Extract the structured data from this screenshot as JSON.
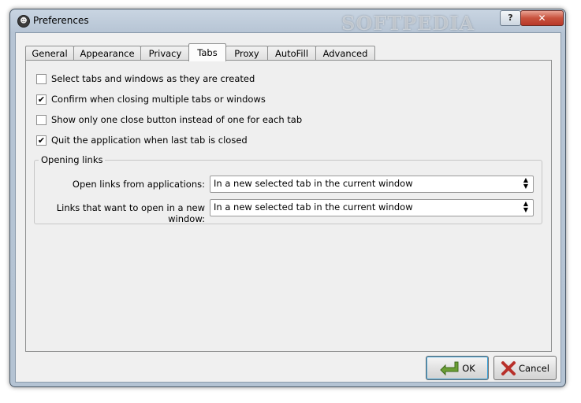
{
  "window": {
    "title": "Preferences",
    "watermark": "SOFTPEDIA",
    "help_label": "?",
    "close_label": "✕"
  },
  "tabs": [
    {
      "label": "General"
    },
    {
      "label": "Appearance"
    },
    {
      "label": "Privacy"
    },
    {
      "label": "Tabs",
      "active": true
    },
    {
      "label": "Proxy"
    },
    {
      "label": "AutoFill"
    },
    {
      "label": "Advanced"
    }
  ],
  "options": [
    {
      "label": "Select tabs and windows as they are created",
      "checked": false
    },
    {
      "label": "Confirm when closing multiple tabs or windows",
      "checked": true
    },
    {
      "label": "Show only one close button instead of one for each tab",
      "checked": false
    },
    {
      "label": "Quit the application when last tab is closed",
      "checked": true
    }
  ],
  "opening_links": {
    "title": "Opening links",
    "fields": [
      {
        "label": "Open links from applications:",
        "value": "In a new selected tab in the current window"
      },
      {
        "label": "Links that want to open in a new window:",
        "value": "In a new selected tab in the current window"
      }
    ]
  },
  "buttons": {
    "ok": "OK",
    "cancel": "Cancel"
  },
  "colors": {
    "ok_icon": "#5a8c2c",
    "cancel_icon": "#c0392b"
  },
  "icons": {
    "app": "app-icon",
    "ok": "check-arrow-icon",
    "cancel": "cross-icon",
    "combo": "updown-arrows-icon"
  }
}
